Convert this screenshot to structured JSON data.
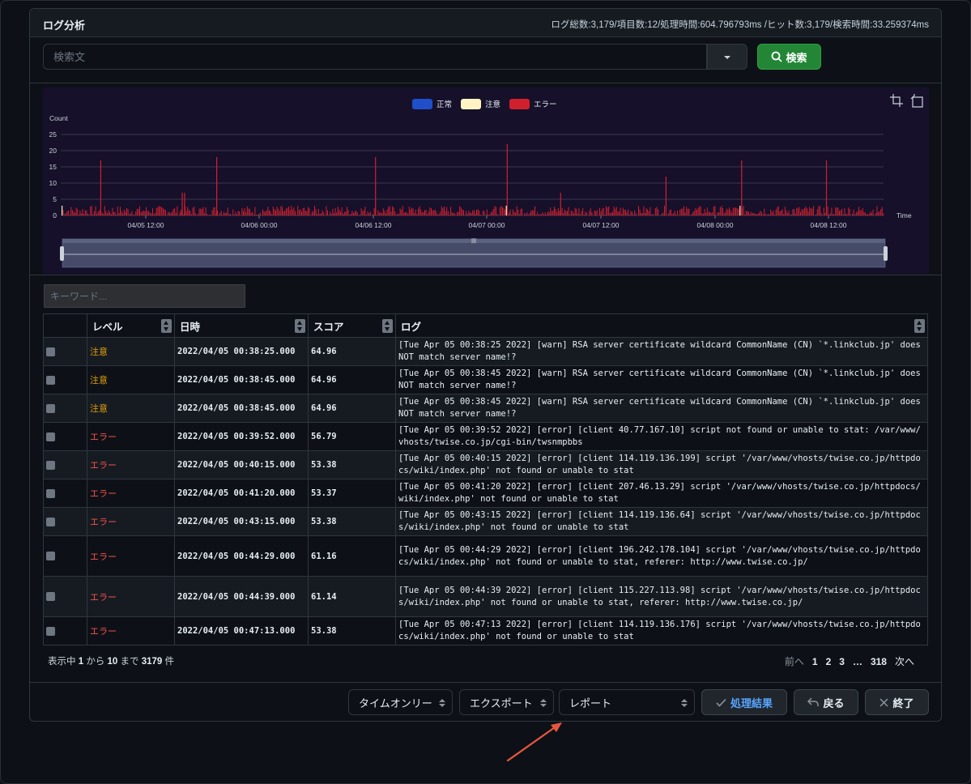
{
  "panel": {
    "title": "ログ分析",
    "stats": "ログ総数:3,179/項目数:12/処理時間:604.796793ms /ヒット数:3,179/検索時間:33.259374ms"
  },
  "search": {
    "placeholder": "検索文",
    "button_label": "検索",
    "button_icon": "search-icon",
    "dropdown_icon": "caret-down-icon"
  },
  "chart_data": {
    "type": "bar",
    "ylabel": "Count",
    "xlabel": "Time",
    "ylim": [
      0,
      25
    ],
    "yticks": [
      0,
      5,
      10,
      15,
      20,
      25
    ],
    "xticks": [
      "04/05 12:00",
      "04/06 00:00",
      "04/06 12:00",
      "04/07 00:00",
      "04/07 12:00",
      "04/08 00:00",
      "04/08 12:00"
    ],
    "legend_position": "top-center",
    "series": [
      {
        "name": "正常",
        "color": "#1f4fc9"
      },
      {
        "name": "注意",
        "color": "#fff3c4"
      },
      {
        "name": "エラー",
        "color": "#d0202e"
      }
    ],
    "toolbox_icons": [
      "zoom-area-icon",
      "zoom-reset-icon"
    ],
    "spikes": [
      {
        "t": 0.048,
        "value": 17
      },
      {
        "t": 0.147,
        "value": 7
      },
      {
        "t": 0.15,
        "value": 7
      },
      {
        "t": 0.189,
        "value": 18
      },
      {
        "t": 0.382,
        "value": 18
      },
      {
        "t": 0.542,
        "value": 22
      },
      {
        "t": 0.607,
        "value": 7
      },
      {
        "t": 0.735,
        "value": 12
      },
      {
        "t": 0.827,
        "value": 17
      },
      {
        "t": 0.93,
        "value": 17
      }
    ],
    "baseline_range": [
      0,
      3
    ]
  },
  "filter": {
    "keyword_placeholder": "キーワード..."
  },
  "table": {
    "columns": [
      "",
      "レベル",
      "日時",
      "スコア",
      "ログ"
    ],
    "level_colors": {
      "注意": "#e3a008",
      "エラー": "#f85149"
    },
    "rows": [
      {
        "level": "注意",
        "date": "2022/04/05 00:38:25.000",
        "score": "64.96",
        "log": "[Tue Apr 05 00:38:25 2022] [warn] RSA server certificate wildcard CommonName (CN) `*.linkclub.jp' does NOT match server name!?"
      },
      {
        "level": "注意",
        "date": "2022/04/05 00:38:45.000",
        "score": "64.96",
        "log": "[Tue Apr 05 00:38:45 2022] [warn] RSA server certificate wildcard CommonName (CN) `*.linkclub.jp' does NOT match server name!?"
      },
      {
        "level": "注意",
        "date": "2022/04/05 00:38:45.000",
        "score": "64.96",
        "log": "[Tue Apr 05 00:38:45 2022] [warn] RSA server certificate wildcard CommonName (CN) `*.linkclub.jp' does NOT match server name!?"
      },
      {
        "level": "エラー",
        "date": "2022/04/05 00:39:52.000",
        "score": "56.79",
        "log": "[Tue Apr 05 00:39:52 2022] [error] [client 40.77.167.10] script not found or unable to stat: /var/www/vhosts/twise.co.jp/cgi-bin/twsnmpbbs"
      },
      {
        "level": "エラー",
        "date": "2022/04/05 00:40:15.000",
        "score": "53.38",
        "log": "[Tue Apr 05 00:40:15 2022] [error] [client 114.119.136.199] script '/var/www/vhosts/twise.co.jp/httpdocs/wiki/index.php' not found or unable to stat"
      },
      {
        "level": "エラー",
        "date": "2022/04/05 00:41:20.000",
        "score": "53.37",
        "log": "[Tue Apr 05 00:41:20 2022] [error] [client 207.46.13.29] script '/var/www/vhosts/twise.co.jp/httpdocs/wiki/index.php' not found or unable to stat"
      },
      {
        "level": "エラー",
        "date": "2022/04/05 00:43:15.000",
        "score": "53.38",
        "log": "[Tue Apr 05 00:43:15 2022] [error] [client 114.119.136.64] script '/var/www/vhosts/twise.co.jp/httpdocs/wiki/index.php' not found or unable to stat"
      },
      {
        "level": "エラー",
        "date": "2022/04/05 00:44:29.000",
        "score": "61.16",
        "log": "[Tue Apr 05 00:44:29 2022] [error] [client 196.242.178.104] script '/var/www/vhosts/twise.co.jp/httpdocs/wiki/index.php' not found or unable to stat, referer: http://www.twise.co.jp/"
      },
      {
        "level": "エラー",
        "date": "2022/04/05 00:44:39.000",
        "score": "61.14",
        "log": "[Tue Apr 05 00:44:39 2022] [error] [client 115.227.113.98] script '/var/www/vhosts/twise.co.jp/httpdocs/wiki/index.php' not found or unable to stat, referer: http://www.twise.co.jp/"
      },
      {
        "level": "エラー",
        "date": "2022/04/05 00:47:13.000",
        "score": "53.38",
        "log": "[Tue Apr 05 00:47:13 2022] [error] [client 114.119.136.176] script '/var/www/vhosts/twise.co.jp/httpdocs/wiki/index.php' not found or unable to stat"
      }
    ]
  },
  "footer": {
    "info_prefix": "表示中",
    "info_from": "1",
    "info_mid1": "から",
    "info_to": "10",
    "info_mid2": "まで",
    "info_total": "3179",
    "info_suffix": "件",
    "pager": [
      "前へ",
      "1",
      "2",
      "3",
      "…",
      "318",
      "次へ"
    ]
  },
  "actions": {
    "timeonly_select": "タイムオンリー",
    "export_select": "エクスポート",
    "report_select": "レポート",
    "result_button": "処理結果",
    "back_button": "戻る",
    "exit_button": "終了"
  }
}
